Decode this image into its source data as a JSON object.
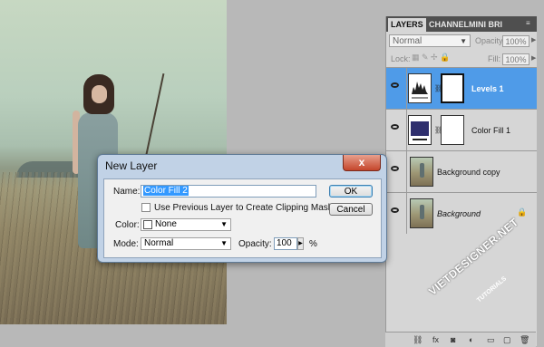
{
  "panel": {
    "tabs": [
      "LAYERS",
      "CHANNEL",
      "MINI BRI"
    ],
    "blend_mode": "Normal",
    "opacity_label": "Opacity:",
    "opacity_value": "100%",
    "lock_label": "Lock:",
    "fill_label": "Fill:",
    "fill_value": "100%",
    "layers": [
      {
        "name": "Levels 1",
        "selected": true
      },
      {
        "name": "Color Fill 1",
        "selected": false
      },
      {
        "name": "Background copy",
        "selected": false
      },
      {
        "name": "Background",
        "selected": false
      }
    ]
  },
  "dialog": {
    "title": "New Layer",
    "close_glyph": "x",
    "name_label": "Name:",
    "name_value": "Color Fill 2",
    "clip_label": "Use Previous Layer to Create Clipping Mask",
    "color_label": "Color:",
    "color_value": "None",
    "mode_label": "Mode:",
    "mode_value": "Normal",
    "opacity_label": "Opacity:",
    "opacity_value": "100",
    "percent": "%",
    "ok": "OK",
    "cancel": "Cancel"
  },
  "watermark": {
    "site": "VIETDESIGNER.NET",
    "sub": "TUTORIALS"
  },
  "colors": {
    "selection": "#4f9be8",
    "color_fill_thumb": "#2f2f6e"
  }
}
